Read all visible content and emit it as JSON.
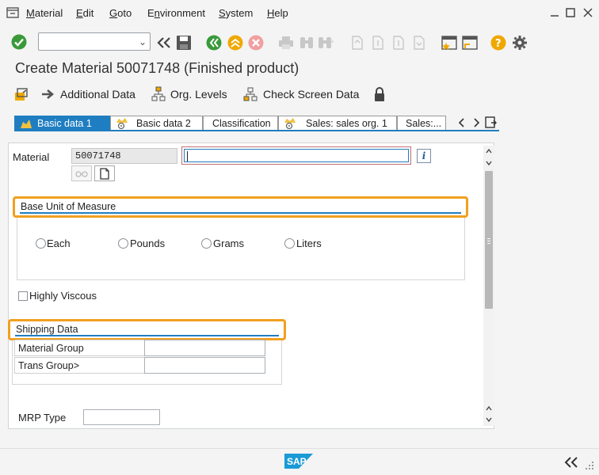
{
  "menu": {
    "items": [
      {
        "label": "Material",
        "underline": "M"
      },
      {
        "label": "Edit",
        "underline": "E"
      },
      {
        "label": "Goto",
        "underline": "G"
      },
      {
        "label": "Environment",
        "underline": "n"
      },
      {
        "label": "System",
        "underline": "S"
      },
      {
        "label": "Help",
        "underline": "H"
      }
    ]
  },
  "toolbar": {
    "command_value": ""
  },
  "title": "Create Material 50071748 (Finished product)",
  "app_toolbar": {
    "additional_data": "Additional Data",
    "org_levels": "Org. Levels",
    "check_screen_data": "Check Screen Data"
  },
  "tabs": [
    {
      "label": "Basic data 1",
      "active": true
    },
    {
      "label": "Basic data 2",
      "active": false
    },
    {
      "label": "Classification",
      "active": false
    },
    {
      "label": "Sales: sales org. 1",
      "active": false
    },
    {
      "label": "Sales:...",
      "active": false
    }
  ],
  "form": {
    "material_label": "Material",
    "material_value": "50071748",
    "description_value": "",
    "base_uom_header": "Base Unit of Measure",
    "uom_options": [
      {
        "label": "Each",
        "selected": false
      },
      {
        "label": "Pounds",
        "selected": false
      },
      {
        "label": "Grams",
        "selected": false
      },
      {
        "label": "Liters",
        "selected": false
      }
    ],
    "highly_viscous_label": "Highly Viscous",
    "highly_viscous_checked": false,
    "shipping_header": "Shipping Data",
    "material_group_label": "Material Group",
    "material_group_value": "",
    "trans_group_label": "Trans Group>",
    "trans_group_value": "",
    "mrp_type_label": "MRP Type",
    "mrp_type_value": ""
  },
  "footer": {
    "logo_text": "SAP"
  },
  "colors": {
    "accent": "#1f7ec1",
    "highlight": "#f0a020",
    "ok_green": "#3a9a3a"
  }
}
